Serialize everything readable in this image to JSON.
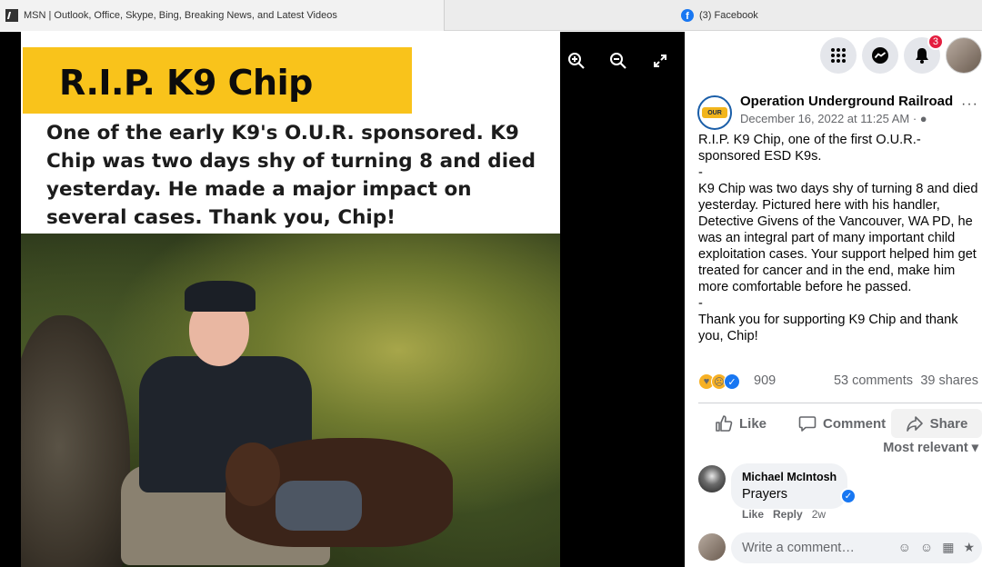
{
  "browser": {
    "tabs": [
      {
        "title": "MSN | Outlook, Office, Skype, Bing, Breaking News, and Latest Videos"
      },
      {
        "title": "(3) Facebook"
      }
    ]
  },
  "photo": {
    "heading": "R.I.P. K9 Chip",
    "caption": "One of the early K9's O.U.R. sponsored. K9 Chip was two days shy of turning 8 and died yesterday. He made a major impact on several cases. Thank you, Chip!"
  },
  "viewer_controls": {
    "zoom_in_icon": "zoom-in-icon",
    "zoom_out_icon": "zoom-out-icon",
    "fullscreen_icon": "fullscreen-icon"
  },
  "header": {
    "notifications_count": "3"
  },
  "post": {
    "page_name": "Operation Underground Railroad",
    "page_avatar_text": "OUR",
    "date": "December 16, 2022 at 11:25 AM · ",
    "paragraphs": [
      "R.I.P. K9 Chip, one of the first O.U.R.-sponsored ESD K9s.",
      "-",
      "K9 Chip was two days shy of turning 8 and died yesterday. Pictured here with his handler, Detective Givens of the Vancouver, WA PD, he was an integral part of many important child exploitation cases. Your support helped him get treated for cancer and in the end, make him more comfortable before he passed.",
      "-",
      "Thank you for supporting K9 Chip and thank you, Chip!"
    ],
    "reactions_count": "909",
    "comments_count": "53 comments",
    "shares_count": "39 shares",
    "actions": {
      "like": "Like",
      "comment": "Comment",
      "share": "Share"
    },
    "sort_label": "Most relevant"
  },
  "comments": [
    {
      "author": "Michael McIntosh",
      "text": "Prayers",
      "like_label": "Like",
      "reply_label": "Reply",
      "age": "2w"
    }
  ],
  "composer": {
    "placeholder": "Write a comment…"
  },
  "colors": {
    "facebook_blue": "#1877f2",
    "banner_yellow": "#f9c31b",
    "notification_red": "#e41e3f"
  }
}
